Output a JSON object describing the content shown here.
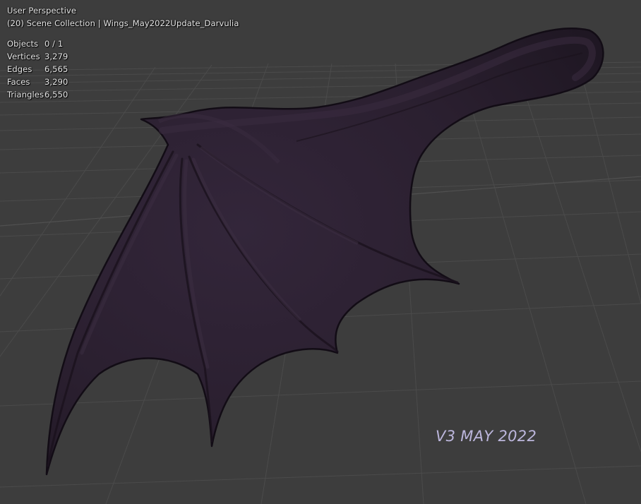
{
  "viewport": {
    "view_name": "User Perspective",
    "collection_path": "(20) Scene Collection | Wings_May2022Update_Darvulia"
  },
  "stats": [
    {
      "label": "Objects",
      "value": "0 / 1"
    },
    {
      "label": "Vertices",
      "value": "3,279"
    },
    {
      "label": "Edges",
      "value": "6,565"
    },
    {
      "label": "Faces",
      "value": "3,290"
    },
    {
      "label": "Triangles",
      "value": "6,550"
    }
  ],
  "watermark": "V3 MAY 2022",
  "colors": {
    "background": "#3d3d3d",
    "grid": "#4a4a4a",
    "wing_base": "#2b2030",
    "wing_edge": "#150f18",
    "overlay_text": "#e6e6e6",
    "watermark": "#bcb6dc"
  }
}
